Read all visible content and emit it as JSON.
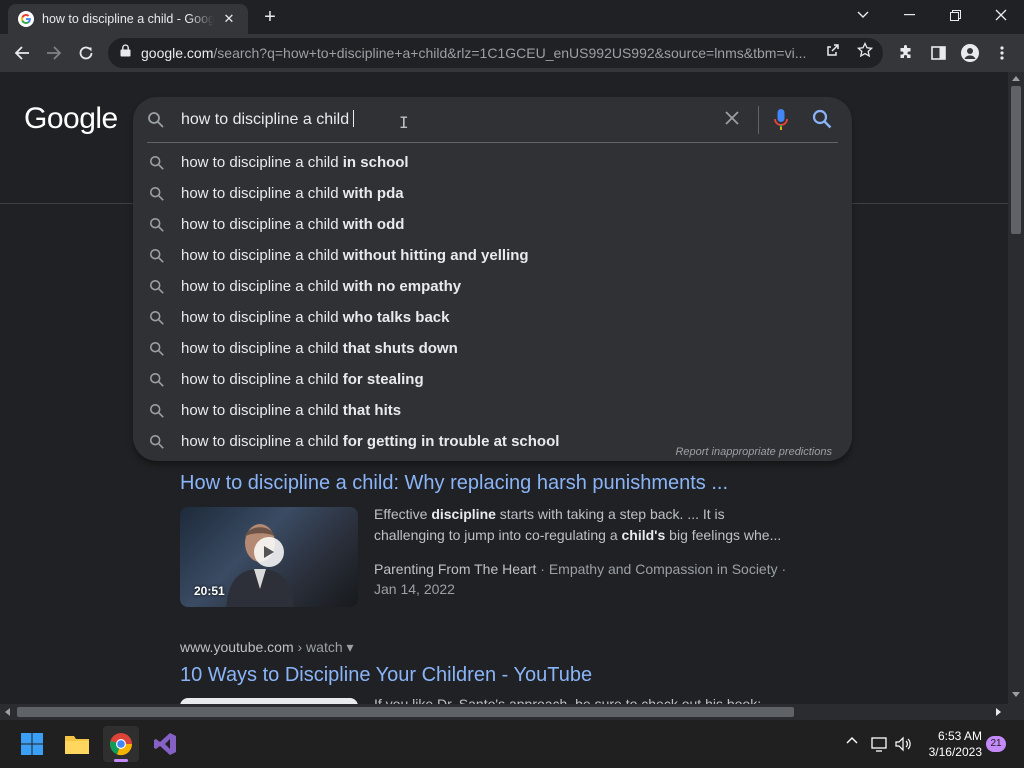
{
  "tab": {
    "title": "how to discipline a child - Google Search",
    "close_glyph": "✕"
  },
  "new_tab_glyph": "+",
  "window": {
    "minimize": "—",
    "restore": "❐",
    "close": "✕",
    "tab_search": "⌄"
  },
  "omnibox": {
    "host": "google.com",
    "path": "/search?q=how+to+discipline+a+child&rlz=1C1GCEU_enUS992US992&source=lnms&tbm=vi..."
  },
  "logo": "Google",
  "search": {
    "query": "how to discipline a child",
    "suggestion_prefix": "how to discipline a child",
    "suggestions": [
      "in school",
      "with pda",
      "with odd",
      "without hitting and yelling",
      "with no empathy",
      "who talks back",
      "that shuts down",
      "for stealing",
      "that hits",
      "for getting in trouble at school"
    ],
    "report_link": "Report inappropriate predictions"
  },
  "results": [
    {
      "title": "How to discipline a child: Why replacing harsh punishments ...",
      "duration": "20:51",
      "snippet_pre": "Effective ",
      "snippet_b1": "discipline",
      "snippet_mid": " starts with taking a step back. ... It is challenging to jump into co-regulating a ",
      "snippet_b2": "child's",
      "snippet_post": " big feelings whe...",
      "source": "Parenting From The Heart",
      "channel": " · Empathy and Compassion in Society · ",
      "date": "Jan 14, 2022"
    },
    {
      "cite_site": "www.youtube.com",
      "cite_path": " › watch",
      "title": "10 Ways to Discipline Your Children - YouTube",
      "snippet": "If you like Dr. Santo's approach, be sure to check out his book:"
    }
  ],
  "taskbar": {
    "time": "6:53 AM",
    "date": "3/16/2023",
    "notifications": "21"
  },
  "colors": {
    "link": "#8ab4f8",
    "accent": "#c58af9",
    "background": "#202124"
  }
}
